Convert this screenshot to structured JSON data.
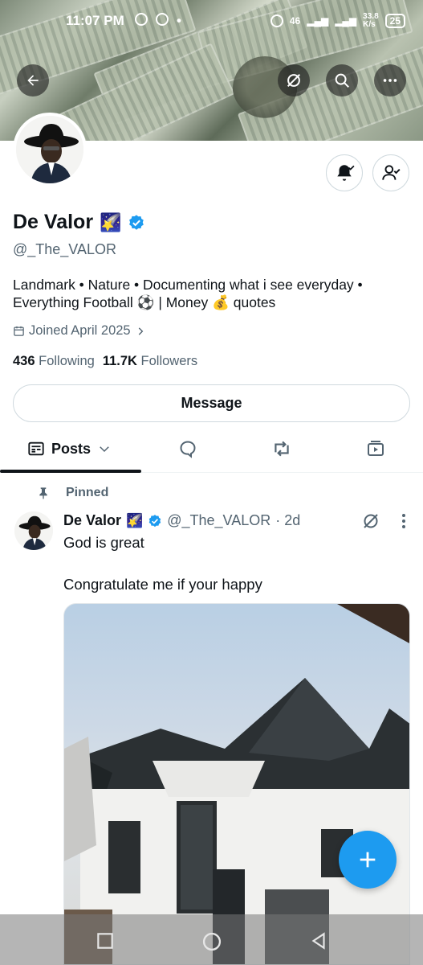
{
  "status_bar": {
    "time": "11:07 PM",
    "network": "46",
    "speed": "33.8\nK/s",
    "battery": "25"
  },
  "profile": {
    "name": "De Valor",
    "name_emoji": "🌠",
    "handle": "@_The_VALOR",
    "bio_line1": "Landmark • Nature • Documenting what i see everyday •",
    "bio_line2": "Everything Football ⚽ | Money 💰 quotes",
    "joined": "Joined April 2025",
    "following_count": "436",
    "following_label": "Following",
    "followers_count": "11.7K",
    "followers_label": "Followers",
    "message_label": "Message"
  },
  "tabs": {
    "posts_label": "Posts"
  },
  "post": {
    "pinned_label": "Pinned",
    "author_name": "De Valor",
    "author_emoji": "🌠",
    "author_handle": "@_The_VALOR",
    "time": "· 2d",
    "text_line1": "God is great",
    "text_line2": "Congratulate me if your happy"
  },
  "colors": {
    "accent": "#1d9bf0",
    "text": "#0f1419",
    "muted": "#536471",
    "border": "#cfd9de"
  }
}
